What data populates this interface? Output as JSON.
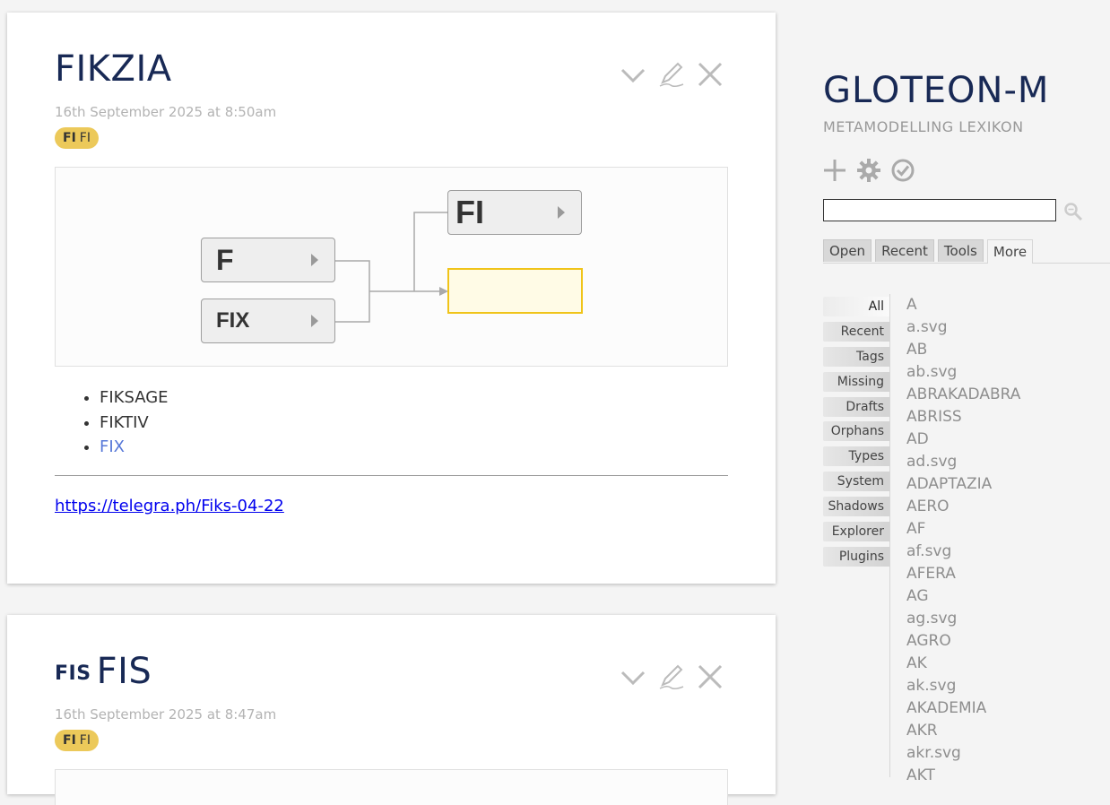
{
  "tiddlers": [
    {
      "title": "FIKZIA",
      "title_prefix": "",
      "date": "16th September 2025 at 8:50am",
      "tag": {
        "icon": "FI",
        "label": "FI"
      },
      "diagram": {
        "nodes": [
          "F",
          "FIX",
          "FI",
          ""
        ]
      },
      "list_items": [
        "FIKSAGE",
        "FIKTIV",
        "FIX"
      ],
      "link": "https://telegra.ph/Fiks-04-22"
    },
    {
      "title": "FIS",
      "title_prefix": "FIS",
      "date": "16th September 2025 at 8:47am",
      "tag": {
        "icon": "FI",
        "label": "FI"
      }
    }
  ],
  "sidebar": {
    "title": "GLOTEON-M",
    "subtitle": "METAMODELLING LEXIKON",
    "search": {
      "value": ""
    },
    "tabs": [
      "Open",
      "Recent",
      "Tools",
      "More"
    ],
    "active_tab": "More",
    "more_tabs": [
      "All",
      "Recent",
      "Tags",
      "Missing",
      "Drafts",
      "Orphans",
      "Types",
      "System",
      "Shadows",
      "Explorer",
      "Plugins"
    ],
    "active_more_tab": "All",
    "all_list": [
      "A",
      "a.svg",
      "AB",
      "ab.svg",
      "ABRAKADABRA",
      "ABRISS",
      "AD",
      "ad.svg",
      "ADAPTAZIA",
      "AERO",
      "AF",
      "af.svg",
      "AFERA",
      "AG",
      "ag.svg",
      "AGRO",
      "AK",
      "ak.svg",
      "AKADEMIA",
      "AKR",
      "akr.svg",
      "AKT"
    ]
  },
  "colors": {
    "title": "#182955",
    "tag_bg": "#ecc95a",
    "link": "#5778d8",
    "empty_node_border": "#f0c419"
  }
}
